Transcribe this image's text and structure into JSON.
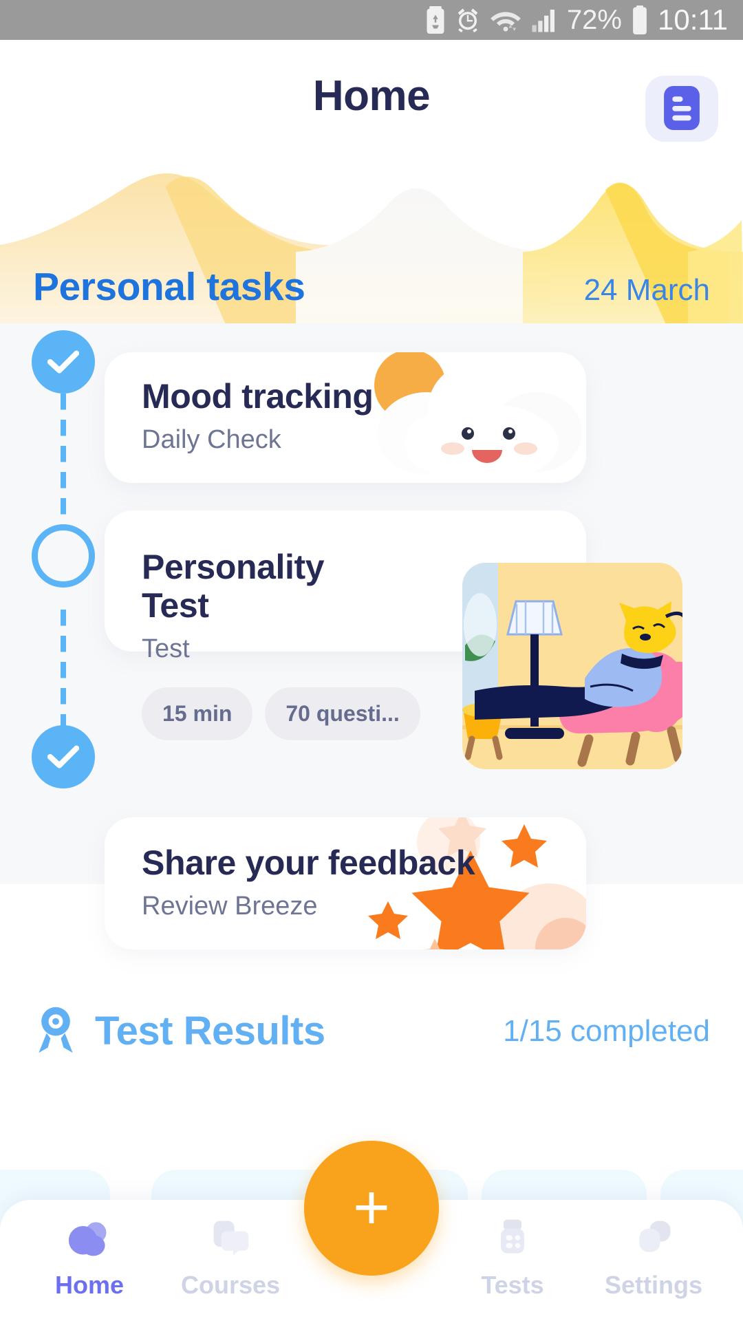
{
  "statusbar": {
    "battery_pct": "72%",
    "time": "10:11",
    "icons": [
      "battery-saver-icon",
      "alarm-icon",
      "wifi-icon",
      "signal-icon",
      "battery-icon"
    ]
  },
  "header": {
    "title": "Home",
    "menu_icon": "document-list-icon"
  },
  "tasks": {
    "section_title": "Personal tasks",
    "date": "24 March",
    "items": [
      {
        "title": "Mood tracking",
        "subtitle": "Daily Check",
        "state": "done",
        "illustration": "smiling-cloud-sun-illustration",
        "chips": []
      },
      {
        "title": "Personality\nTest",
        "title_line1": "Personality",
        "title_line2": "Test",
        "subtitle": "Test",
        "state": "current",
        "illustration": "cat-on-lounge-chair-illustration",
        "chips": [
          "15 min",
          "70 questi..."
        ]
      },
      {
        "title": "Share your feedback",
        "subtitle": "Review Breeze",
        "state": "done",
        "illustration": "orange-stars-illustration",
        "chips": []
      }
    ]
  },
  "results": {
    "icon": "medal-ribbon-icon",
    "title": "Test Results",
    "count": "1/15 completed"
  },
  "bottomnav": {
    "items": [
      {
        "label": "Home",
        "icon": "home-cloud-icon",
        "active": true
      },
      {
        "label": "Courses",
        "icon": "book-chat-icon",
        "active": false
      },
      {
        "label": "Tests",
        "icon": "clipboard-icon",
        "active": false
      },
      {
        "label": "Settings",
        "icon": "gears-icon",
        "active": false
      }
    ],
    "fab": {
      "label": "+",
      "icon": "plus-icon"
    }
  },
  "colors": {
    "accent_blue": "#5ab4f5",
    "title_blue": "#1f73dd",
    "results_blue": "#62b0f4",
    "navy": "#262a54",
    "orange": "#f9a21b",
    "purple": "#6c6ff0",
    "chip_bg": "#ececf1"
  }
}
